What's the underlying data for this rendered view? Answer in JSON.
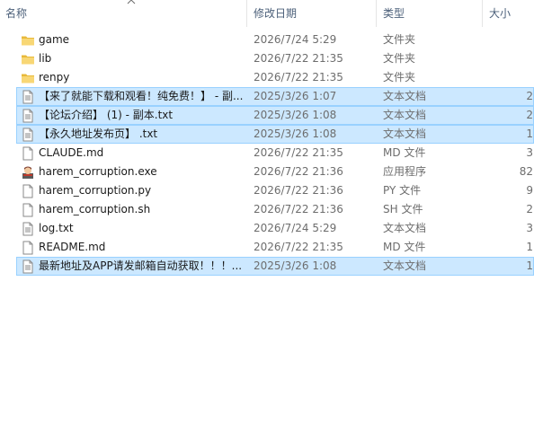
{
  "columns": {
    "name": "名称",
    "date": "修改日期",
    "type": "类型",
    "size": "大小"
  },
  "files": [
    {
      "name": "game",
      "date": "2026/7/24 5:29",
      "type": "文件夹",
      "size": "",
      "icon": "folder-icon",
      "selected": false
    },
    {
      "name": "lib",
      "date": "2026/7/22 21:35",
      "type": "文件夹",
      "size": "",
      "icon": "folder-icon",
      "selected": false
    },
    {
      "name": "renpy",
      "date": "2026/7/22 21:35",
      "type": "文件夹",
      "size": "",
      "icon": "folder-icon",
      "selected": false
    },
    {
      "name": "【来了就能下载和观看！纯免费！】 - 副...",
      "date": "2025/3/26 1:07",
      "type": "文本文档",
      "size": "2",
      "icon": "text-file-icon",
      "selected": true
    },
    {
      "name": "【论坛介绍】 (1) - 副本.txt",
      "date": "2025/3/26 1:08",
      "type": "文本文档",
      "size": "2",
      "icon": "text-file-icon",
      "selected": true
    },
    {
      "name": "【永久地址发布页】 .txt",
      "date": "2025/3/26 1:08",
      "type": "文本文档",
      "size": "1",
      "icon": "text-file-icon",
      "selected": true
    },
    {
      "name": "CLAUDE.md",
      "date": "2026/7/22 21:35",
      "type": "MD 文件",
      "size": "3",
      "icon": "blank-file-icon",
      "selected": false
    },
    {
      "name": "harem_corruption.exe",
      "date": "2026/7/22 21:36",
      "type": "应用程序",
      "size": "82",
      "icon": "app-icon",
      "selected": false
    },
    {
      "name": "harem_corruption.py",
      "date": "2026/7/22 21:36",
      "type": "PY 文件",
      "size": "9",
      "icon": "blank-file-icon",
      "selected": false
    },
    {
      "name": "harem_corruption.sh",
      "date": "2026/7/22 21:36",
      "type": "SH 文件",
      "size": "2",
      "icon": "blank-file-icon",
      "selected": false
    },
    {
      "name": "log.txt",
      "date": "2026/7/24 5:29",
      "type": "文本文档",
      "size": "3",
      "icon": "text-file-icon",
      "selected": false
    },
    {
      "name": "README.md",
      "date": "2026/7/22 21:35",
      "type": "MD 文件",
      "size": "1",
      "icon": "blank-file-icon",
      "selected": false
    },
    {
      "name": "最新地址及APP请发邮箱自动获取！！！...",
      "date": "2025/3/26 1:08",
      "type": "文本文档",
      "size": "1",
      "icon": "text-file-icon",
      "selected": true
    }
  ],
  "colors": {
    "selection_bg": "#cce8ff",
    "selection_border": "#99d1ff",
    "folder": "#f8d775",
    "header_text": "#4c607a"
  }
}
